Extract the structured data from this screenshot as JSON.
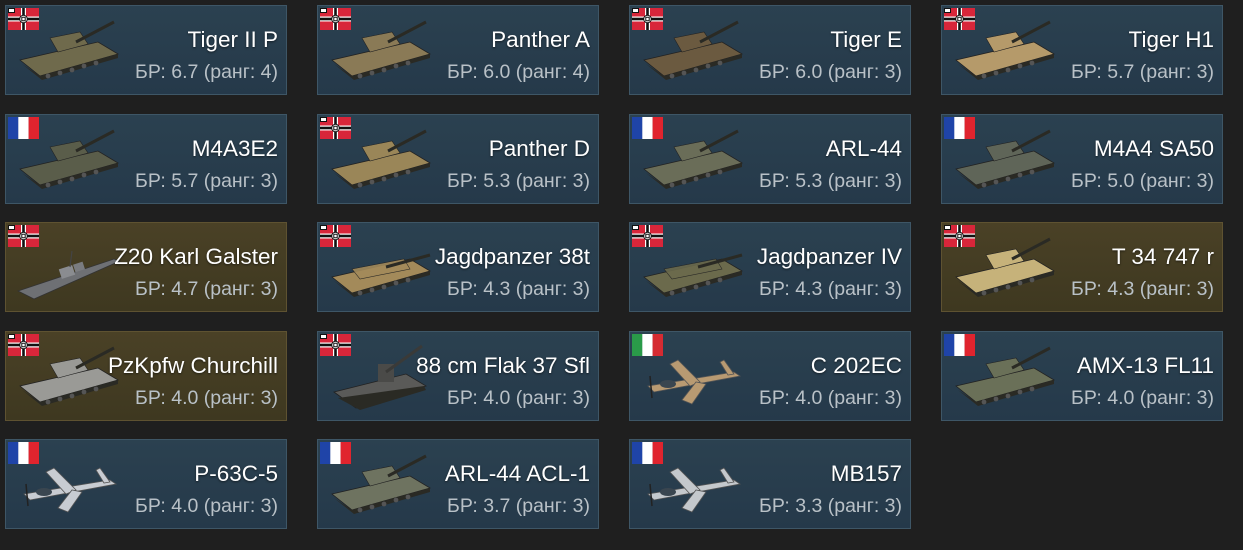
{
  "vehicles": [
    {
      "name": "Tiger II P",
      "br": "БР: 6.7 (ранг: 4)",
      "nation": "germany",
      "kind": "tank",
      "camo": "#6f6a4c",
      "premium": false
    },
    {
      "name": "Panther A",
      "br": "БР: 6.0 (ранг: 4)",
      "nation": "germany",
      "kind": "tank",
      "camo": "#8a7a56",
      "premium": false
    },
    {
      "name": "Tiger E",
      "br": "БР: 6.0 (ранг: 3)",
      "nation": "germany",
      "kind": "tank",
      "camo": "#6b5a40",
      "premium": false
    },
    {
      "name": "Tiger H1",
      "br": "БР: 5.7 (ранг: 3)",
      "nation": "germany",
      "kind": "tank",
      "camo": "#b59a6a",
      "premium": false
    },
    {
      "name": "M4A3E2",
      "br": "БР: 5.7 (ранг: 3)",
      "nation": "france",
      "kind": "tank",
      "camo": "#5a5d4a",
      "premium": false
    },
    {
      "name": "Panther D",
      "br": "БР: 5.3 (ранг: 3)",
      "nation": "germany",
      "kind": "tank",
      "camo": "#9a8658",
      "premium": false
    },
    {
      "name": "ARL-44",
      "br": "БР: 5.3 (ранг: 3)",
      "nation": "france",
      "kind": "tank",
      "camo": "#6a6d58",
      "premium": false
    },
    {
      "name": "M4A4 SA50",
      "br": "БР: 5.0 (ранг: 3)",
      "nation": "france",
      "kind": "tank",
      "camo": "#5f6558",
      "premium": false
    },
    {
      "name": "Z20 Karl Galster",
      "br": "БР: 4.7 (ранг: 3)",
      "nation": "germany",
      "kind": "ship",
      "camo": "#6e7074",
      "premium": true
    },
    {
      "name": "Jagdpanzer 38t",
      "br": "БР: 4.3 (ранг: 3)",
      "nation": "germany",
      "kind": "td",
      "camo": "#a38a5a",
      "premium": false
    },
    {
      "name": "Jagdpanzer IV",
      "br": "БР: 4.3 (ранг: 3)",
      "nation": "germany",
      "kind": "td",
      "camo": "#6b6a4c",
      "premium": false
    },
    {
      "name": "T 34 747 r",
      "br": "БР: 4.3 (ранг: 3)",
      "nation": "germany",
      "kind": "tank",
      "camo": "#c6b27a",
      "premium": true
    },
    {
      "name": "PzKpfw Churchill",
      "br": "БР: 4.0 (ранг: 3)",
      "nation": "germany",
      "kind": "tank",
      "camo": "#9a9a96",
      "premium": true
    },
    {
      "name": "88 cm Flak 37 Sfl",
      "br": "БР: 4.0 (ранг: 3)",
      "nation": "germany",
      "kind": "spaa",
      "camo": "#5a5a58",
      "premium": false
    },
    {
      "name": "C 202EC",
      "br": "БР: 4.0 (ранг: 3)",
      "nation": "italy",
      "kind": "plane",
      "camo": "#b89a72",
      "premium": false
    },
    {
      "name": "AMX-13 FL11",
      "br": "БР: 4.0 (ранг: 3)",
      "nation": "france",
      "kind": "tank",
      "camo": "#6a7058",
      "premium": false
    },
    {
      "name": "P-63C-5",
      "br": "БР: 4.0 (ранг: 3)",
      "nation": "france",
      "kind": "plane",
      "camo": "#c8ccd2",
      "premium": false
    },
    {
      "name": "ARL-44 ACL-1",
      "br": "БР: 3.7 (ранг: 3)",
      "nation": "france",
      "kind": "tank",
      "camo": "#6e7360",
      "premium": false
    },
    {
      "name": "MB157",
      "br": "БР: 3.3 (ранг: 3)",
      "nation": "france",
      "kind": "plane",
      "camo": "#c4c8cc",
      "premium": false
    }
  ],
  "icons": {
    "germany": "germany-flag-icon",
    "france": "france-flag-icon",
    "italy": "italy-flag-icon"
  },
  "colors": {
    "background": "#1f1f1f",
    "card": "#2b4150",
    "card_border": "#3e5666",
    "premium_card": "#4a4126",
    "name_text": "#ffffff",
    "br_text": "#b9c1c7"
  }
}
